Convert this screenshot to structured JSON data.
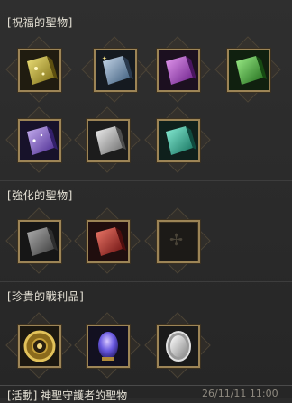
{
  "sections": [
    {
      "title": "[祝福的聖物]"
    },
    {
      "title": "[強化的聖物]"
    },
    {
      "title": "[珍貴的戰利品]"
    }
  ],
  "items": {
    "blessed": [
      {
        "name": "gold-relic-icon",
        "color": "#c9b83a"
      },
      {
        "name": "blue-relic-icon",
        "color": "#6f8fb0"
      },
      {
        "name": "purple-relic-icon",
        "color": "#a24fc2"
      },
      {
        "name": "green-relic-icon",
        "color": "#3fae3a"
      },
      {
        "name": "violet-relic-icon",
        "color": "#7c58c8"
      },
      {
        "name": "silver-relic-icon",
        "color": "#b8b8b8"
      },
      {
        "name": "teal-relic-icon",
        "color": "#2cb59a"
      }
    ],
    "enhanced": [
      {
        "name": "gray-relic-icon",
        "color": "#8a8a8a"
      },
      {
        "name": "red-relic-icon",
        "color": "#c0302a"
      },
      {
        "name": "empty-slot-icon",
        "color": "#1c1a17"
      }
    ],
    "loot": [
      {
        "name": "golden-gear-icon",
        "color": "#c8a23a"
      },
      {
        "name": "crystal-egg-icon",
        "color": "#7a6ae0"
      },
      {
        "name": "silver-mirror-icon",
        "color": "#cfcfcf"
      }
    ]
  },
  "footer": {
    "label": "[活動] 神聖守護者的聖物",
    "date": "26/11/11 11:00"
  }
}
